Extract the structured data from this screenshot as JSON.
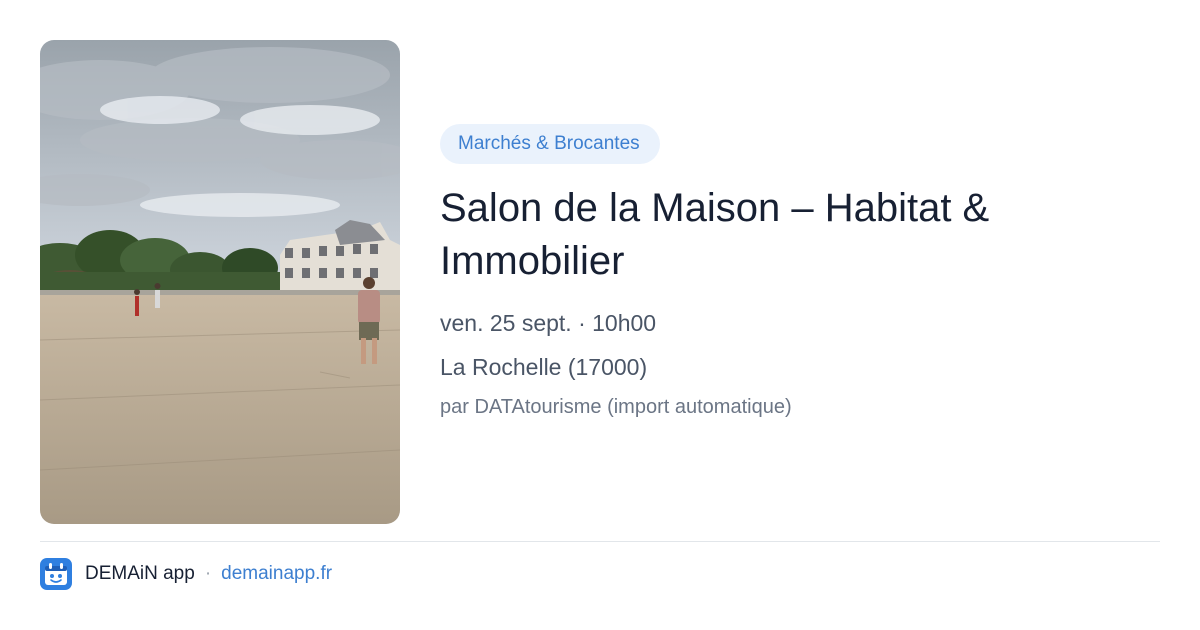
{
  "event": {
    "category": "Marchés & Brocantes",
    "title": "Salon de la Maison – Habitat & Immobilier",
    "date": "ven. 25 sept. · 10h00",
    "location": "La Rochelle (17000)",
    "source": "par DATAtourisme (import automatique)"
  },
  "footer": {
    "app_name": "DEMAiN app",
    "separator": "·",
    "site": "demainapp.fr"
  },
  "photo": {
    "subject": "town square with historic buildings and trees under a cloudy sky"
  },
  "colors": {
    "accent": "#3d7fd0",
    "pill_background": "#eaf2fc",
    "title": "#172033",
    "body": "#4a5566",
    "muted": "#6b7585",
    "divider": "#e2e6ea"
  }
}
